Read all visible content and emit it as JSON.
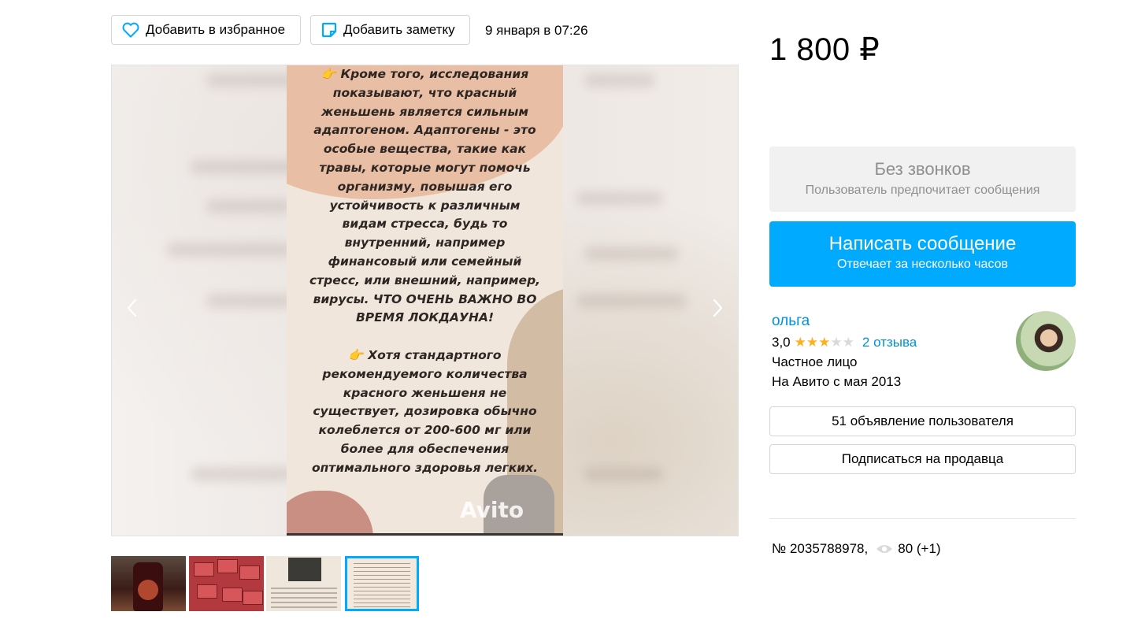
{
  "header": {
    "favorite_label": "Добавить в избранное",
    "note_label": "Добавить заметку",
    "date": "9 января в 07:26"
  },
  "price": "1 800 ₽",
  "gallery": {
    "image_text": "👉 Кроме того, исследования\nпоказывают, что красный\nженьшень является сильным\nадаптогеном. Адаптогены - это\nособые вещества, такие как\nтравы, которые могут помочь\nорганизму, повышая его\nустойчивость к различным\nвидам стресса, будь то\nвнутренний, например\nфинансовый или семейный\nстресс, или внешний, например,\nвирусы. ЧТО ОЧЕНЬ ВАЖНО ВО\nВРЕМЯ ЛОКДАУНА!\n\n👉 Хотя стандартного\nрекомендуемого количества\nкрасного женьшеня не\nсуществует, дозировка обычно\nколеблется от 200-600 мг или\nболее для обеспечения\nоптимального здоровья легких.",
    "watermark": "Avito",
    "prev_icon": "chevron-left-icon",
    "next_icon": "chevron-right-icon",
    "thumbnails": [
      {
        "label": "",
        "selected": false
      },
      {
        "label": "",
        "selected": false
      },
      {
        "label": "",
        "selected": false
      },
      {
        "label": "",
        "selected": true
      }
    ]
  },
  "contact": {
    "no_calls_title": "Без звонков",
    "no_calls_subtitle": "Пользователь предпочитает сообщения",
    "message_button": "Написать сообщение",
    "message_subtitle": "Отвечает за несколько часов"
  },
  "seller": {
    "name": "ольга",
    "rating": "3,0",
    "stars_filled": 3,
    "stars_total": 5,
    "reviews": "2 отзыва",
    "type": "Частное лицо",
    "since": "На Авито с мая 2013",
    "ads_button": "51 объявление пользователя",
    "subscribe_button": "Подписаться на продавца"
  },
  "item": {
    "number": "№ 2035788978,",
    "views": "80 (+1)"
  },
  "colors": {
    "accent": "#00aaff",
    "link": "#0091d9",
    "star": "#ffb021"
  }
}
